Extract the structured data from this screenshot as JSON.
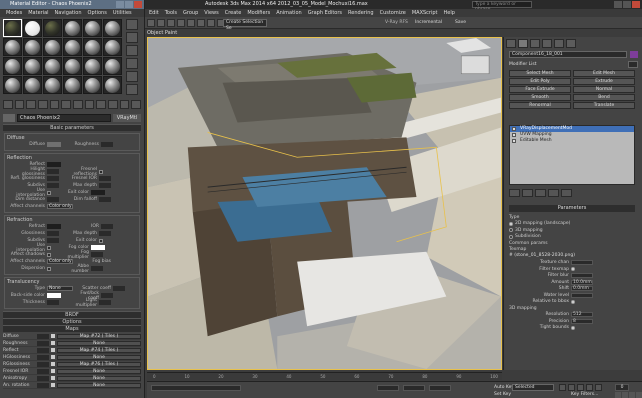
{
  "mat_editor": {
    "title": "Material Editor - Chaos Phoenix2",
    "menu": [
      "Modes",
      "Material",
      "Navigation",
      "Options",
      "Utilities"
    ],
    "material_name": "Chaos Phoenix2",
    "material_type": "VRayMtl",
    "rollouts": {
      "basic_params": "Basic parameters",
      "diffuse_group": "Diffuse",
      "diffuse": "Diffuse",
      "roughness": "Roughness",
      "reflection_group": "Reflection",
      "reflect": "Reflect",
      "hilight_gloss": "Hilight glossiness",
      "refl_gloss": "Refl. glossiness",
      "subdivs": "Subdivs",
      "use_interp": "Use interpolation",
      "dim_distance": "Dim distance",
      "affect_channels": "Affect channels",
      "fresnel_refl": "Fresnel reflections",
      "fresnel_ior": "Fresnel IOR",
      "max_depth": "Max depth",
      "exit_color": "Exit color",
      "dim_falloff": "Dim falloff",
      "color_only": "Color only",
      "refraction_group": "Refraction",
      "refract": "Refract",
      "glossiness": "Glossiness",
      "ior": "IOR",
      "fog_color": "Fog color",
      "fog_multiplier": "Fog multiplier",
      "fog_bias": "Fog bias",
      "affect_shadows": "Affect shadows",
      "abbe": "Abbe number",
      "dispersion": "Dispersion",
      "translucency_group": "Translucency",
      "type": "Type",
      "type_val": "None",
      "back_side": "Back-side color",
      "thickness": "Thickness",
      "scatter_coeff": "Scatter coeff",
      "fwd_bck": "Fwd/bck coeff",
      "light_mult": "Light multiplier",
      "brdf": "BRDF",
      "options": "Options",
      "maps": "Maps"
    },
    "maps": [
      {
        "name": "Diffuse",
        "btn": "Map #72 ( Tiles )"
      },
      {
        "name": "Roughness",
        "btn": "None"
      },
      {
        "name": "Reflect",
        "btn": "Map #74 ( Tiles )"
      },
      {
        "name": "HGlossiness",
        "btn": "None"
      },
      {
        "name": "RGlossiness",
        "btn": "Map #76 ( Tiles )"
      },
      {
        "name": "Fresnel IOR",
        "btn": "None"
      },
      {
        "name": "Anisotropy",
        "btn": "None"
      },
      {
        "name": "An. rotation",
        "btn": "None"
      }
    ]
  },
  "main": {
    "title": "Autodesk 3ds Max 2014 x64      2012_03_05_Model_Mochuxi16.max",
    "search_placeholder": "Type a keyword or phrase",
    "menu": [
      "Edit",
      "Tools",
      "Group",
      "Views",
      "Create",
      "Modifiers",
      "Animation",
      "Graph Editors",
      "Rendering",
      "Customize",
      "MAXScript",
      "Help"
    ],
    "selection_set": "Create Selection Se",
    "vray_fps": "V-Ray RFS",
    "incremental": "Incremental",
    "save": "Save",
    "viewport_label": "Object Paint"
  },
  "cmd_panel": {
    "object_name": "Component16_18_001",
    "modifier_list": "Modifier List",
    "mod_buttons": [
      "Select Mesh",
      "Edit Mesh",
      "Edit Poly",
      "Extrude",
      "Face Extrude",
      "Normal",
      "Smooth",
      "Bend",
      "Renormal",
      "Translate"
    ],
    "stack": [
      "VRayDisplacementMod",
      "UVW Mapping",
      "Editable Mesh"
    ],
    "params_title": "Parameters",
    "type_label": "Type",
    "type_options": [
      "2D mapping (landscape)",
      "3D mapping",
      "Subdivision"
    ],
    "common_params": "Common params",
    "texmap_label": "Texmap",
    "texmap_file": "# (stone_01_8528-2030.png)",
    "texture_chan": "Texture chan",
    "filter_texmap": "Filter texmap",
    "filter_blur": "Filter blur",
    "amount": "Amount",
    "amount_val": "10.0mm",
    "shift": "Shift",
    "shift_val": "0.0mm",
    "water_level": "Water level",
    "relative_to_bbox": "Relative to bbox",
    "mapping_3d": "3D mapping",
    "resolution": "Resolution",
    "resolution_val": "512",
    "precision": "Precision",
    "precision_val": "8",
    "tight_bounds": "Tight bounds"
  },
  "status": {
    "auto_key": "Auto Key",
    "selected": "Selected",
    "set_key": "Set Key",
    "key_filters": "Key Filters...",
    "frame": "0",
    "timeline": [
      "0",
      "10",
      "20",
      "30",
      "40",
      "50",
      "60",
      "70",
      "80",
      "90",
      "100"
    ]
  },
  "colors": {
    "accent": "#3f6fb7",
    "viewport_border": "#e8c14b",
    "object_color": "#7e3d9a"
  }
}
